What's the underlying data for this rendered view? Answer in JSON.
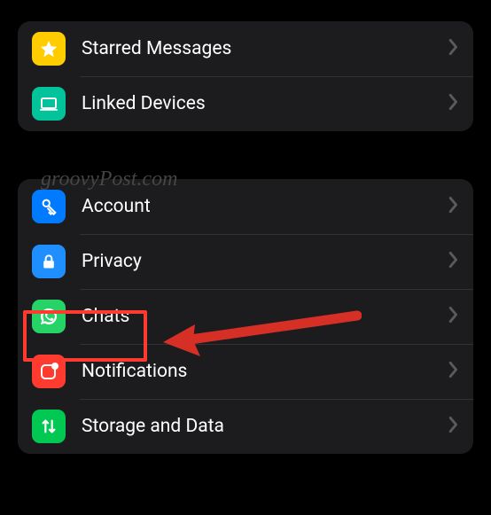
{
  "watermark": "groovyPost.com",
  "sections": [
    {
      "items": [
        {
          "label": "Starred Messages",
          "icon": "star-icon"
        },
        {
          "label": "Linked Devices",
          "icon": "laptop-icon"
        }
      ]
    },
    {
      "items": [
        {
          "label": "Account",
          "icon": "key-icon"
        },
        {
          "label": "Privacy",
          "icon": "lock-icon"
        },
        {
          "label": "Chats",
          "icon": "whatsapp-icon",
          "highlighted": true
        },
        {
          "label": "Notifications",
          "icon": "notification-icon"
        },
        {
          "label": "Storage and Data",
          "icon": "arrows-updown-icon"
        }
      ]
    }
  ],
  "annotation": {
    "highlight_target": "Chats",
    "arrow_points_to": "Chats"
  }
}
